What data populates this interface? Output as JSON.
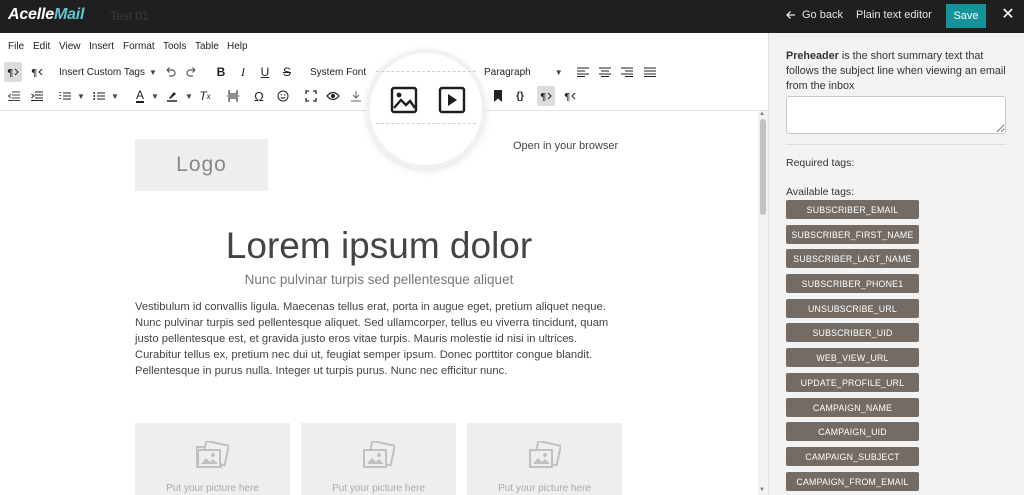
{
  "app": {
    "logo_a": "Acelle",
    "logo_b": "Mail",
    "ghost_title": "Test 01"
  },
  "header": {
    "go_back": "Go back",
    "plain_text": "Plain text editor",
    "save": "Save",
    "close": "✕"
  },
  "menu": [
    "File",
    "Edit",
    "View",
    "Insert",
    "Format",
    "Tools",
    "Table",
    "Help"
  ],
  "toolbar": {
    "custom_tags": "Insert Custom Tags",
    "font": "System Font",
    "block": "Paragraph",
    "tags_brace": "{}"
  },
  "content": {
    "logo": "Logo",
    "open_browser": "Open in your browser",
    "title": "Lorem ipsum dolor",
    "subtitle": "Nunc pulvinar turpis sed pellentesque aliquet",
    "body": "Vestibulum id convallis ligula. Maecenas tellus erat, porta in augue eget, pretium aliquet neque. Nunc pulvinar turpis sed pellentesque aliquet. Sed ullamcorper, tellus eu viverra tincidunt, quam justo pellentesque est, et gravida justo eros vitae turpis. Mauris molestie id nisi in ultrices. Curabitur tellus ex, pretium nec dui ut, feugiat semper ipsum. Donec porttitor congue blandit. Pellentesque in purus nulla. Integer ut turpis purus. Nunc nec efficitur nunc.",
    "picture_label": "Put your picture here"
  },
  "panel": {
    "preheader_bold": "Preheader",
    "preheader_text": " is the short summary text that follows the subject line when viewing an email from the inbox",
    "required": "Required tags:",
    "available": "Available tags:",
    "tags": [
      "SUBSCRIBER_EMAIL",
      "SUBSCRIBER_FIRST_NAME",
      "SUBSCRIBER_LAST_NAME",
      "SUBSCRIBER_PHONE1",
      "UNSUBSCRIBE_URL",
      "SUBSCRIBER_UID",
      "WEB_VIEW_URL",
      "UPDATE_PROFILE_URL",
      "CAMPAIGN_NAME",
      "CAMPAIGN_UID",
      "CAMPAIGN_SUBJECT",
      "CAMPAIGN_FROM_EMAIL"
    ]
  },
  "colors": {
    "save_button": "#14939a",
    "tag_bg": "#736b64",
    "topbar": "#1f1f1f"
  }
}
